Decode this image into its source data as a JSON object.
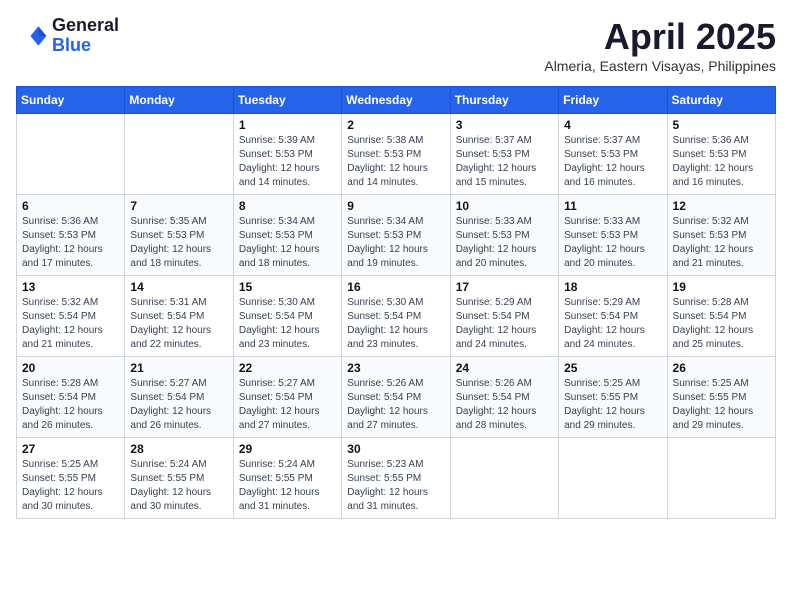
{
  "logo": {
    "general": "General",
    "blue": "Blue"
  },
  "title": {
    "month_year": "April 2025",
    "location": "Almeria, Eastern Visayas, Philippines"
  },
  "headers": [
    "Sunday",
    "Monday",
    "Tuesday",
    "Wednesday",
    "Thursday",
    "Friday",
    "Saturday"
  ],
  "weeks": [
    [
      {
        "day": "",
        "info": ""
      },
      {
        "day": "",
        "info": ""
      },
      {
        "day": "1",
        "info": "Sunrise: 5:39 AM\nSunset: 5:53 PM\nDaylight: 12 hours and 14 minutes."
      },
      {
        "day": "2",
        "info": "Sunrise: 5:38 AM\nSunset: 5:53 PM\nDaylight: 12 hours and 14 minutes."
      },
      {
        "day": "3",
        "info": "Sunrise: 5:37 AM\nSunset: 5:53 PM\nDaylight: 12 hours and 15 minutes."
      },
      {
        "day": "4",
        "info": "Sunrise: 5:37 AM\nSunset: 5:53 PM\nDaylight: 12 hours and 16 minutes."
      },
      {
        "day": "5",
        "info": "Sunrise: 5:36 AM\nSunset: 5:53 PM\nDaylight: 12 hours and 16 minutes."
      }
    ],
    [
      {
        "day": "6",
        "info": "Sunrise: 5:36 AM\nSunset: 5:53 PM\nDaylight: 12 hours and 17 minutes."
      },
      {
        "day": "7",
        "info": "Sunrise: 5:35 AM\nSunset: 5:53 PM\nDaylight: 12 hours and 18 minutes."
      },
      {
        "day": "8",
        "info": "Sunrise: 5:34 AM\nSunset: 5:53 PM\nDaylight: 12 hours and 18 minutes."
      },
      {
        "day": "9",
        "info": "Sunrise: 5:34 AM\nSunset: 5:53 PM\nDaylight: 12 hours and 19 minutes."
      },
      {
        "day": "10",
        "info": "Sunrise: 5:33 AM\nSunset: 5:53 PM\nDaylight: 12 hours and 20 minutes."
      },
      {
        "day": "11",
        "info": "Sunrise: 5:33 AM\nSunset: 5:53 PM\nDaylight: 12 hours and 20 minutes."
      },
      {
        "day": "12",
        "info": "Sunrise: 5:32 AM\nSunset: 5:53 PM\nDaylight: 12 hours and 21 minutes."
      }
    ],
    [
      {
        "day": "13",
        "info": "Sunrise: 5:32 AM\nSunset: 5:54 PM\nDaylight: 12 hours and 21 minutes."
      },
      {
        "day": "14",
        "info": "Sunrise: 5:31 AM\nSunset: 5:54 PM\nDaylight: 12 hours and 22 minutes."
      },
      {
        "day": "15",
        "info": "Sunrise: 5:30 AM\nSunset: 5:54 PM\nDaylight: 12 hours and 23 minutes."
      },
      {
        "day": "16",
        "info": "Sunrise: 5:30 AM\nSunset: 5:54 PM\nDaylight: 12 hours and 23 minutes."
      },
      {
        "day": "17",
        "info": "Sunrise: 5:29 AM\nSunset: 5:54 PM\nDaylight: 12 hours and 24 minutes."
      },
      {
        "day": "18",
        "info": "Sunrise: 5:29 AM\nSunset: 5:54 PM\nDaylight: 12 hours and 24 minutes."
      },
      {
        "day": "19",
        "info": "Sunrise: 5:28 AM\nSunset: 5:54 PM\nDaylight: 12 hours and 25 minutes."
      }
    ],
    [
      {
        "day": "20",
        "info": "Sunrise: 5:28 AM\nSunset: 5:54 PM\nDaylight: 12 hours and 26 minutes."
      },
      {
        "day": "21",
        "info": "Sunrise: 5:27 AM\nSunset: 5:54 PM\nDaylight: 12 hours and 26 minutes."
      },
      {
        "day": "22",
        "info": "Sunrise: 5:27 AM\nSunset: 5:54 PM\nDaylight: 12 hours and 27 minutes."
      },
      {
        "day": "23",
        "info": "Sunrise: 5:26 AM\nSunset: 5:54 PM\nDaylight: 12 hours and 27 minutes."
      },
      {
        "day": "24",
        "info": "Sunrise: 5:26 AM\nSunset: 5:54 PM\nDaylight: 12 hours and 28 minutes."
      },
      {
        "day": "25",
        "info": "Sunrise: 5:25 AM\nSunset: 5:55 PM\nDaylight: 12 hours and 29 minutes."
      },
      {
        "day": "26",
        "info": "Sunrise: 5:25 AM\nSunset: 5:55 PM\nDaylight: 12 hours and 29 minutes."
      }
    ],
    [
      {
        "day": "27",
        "info": "Sunrise: 5:25 AM\nSunset: 5:55 PM\nDaylight: 12 hours and 30 minutes."
      },
      {
        "day": "28",
        "info": "Sunrise: 5:24 AM\nSunset: 5:55 PM\nDaylight: 12 hours and 30 minutes."
      },
      {
        "day": "29",
        "info": "Sunrise: 5:24 AM\nSunset: 5:55 PM\nDaylight: 12 hours and 31 minutes."
      },
      {
        "day": "30",
        "info": "Sunrise: 5:23 AM\nSunset: 5:55 PM\nDaylight: 12 hours and 31 minutes."
      },
      {
        "day": "",
        "info": ""
      },
      {
        "day": "",
        "info": ""
      },
      {
        "day": "",
        "info": ""
      }
    ]
  ]
}
